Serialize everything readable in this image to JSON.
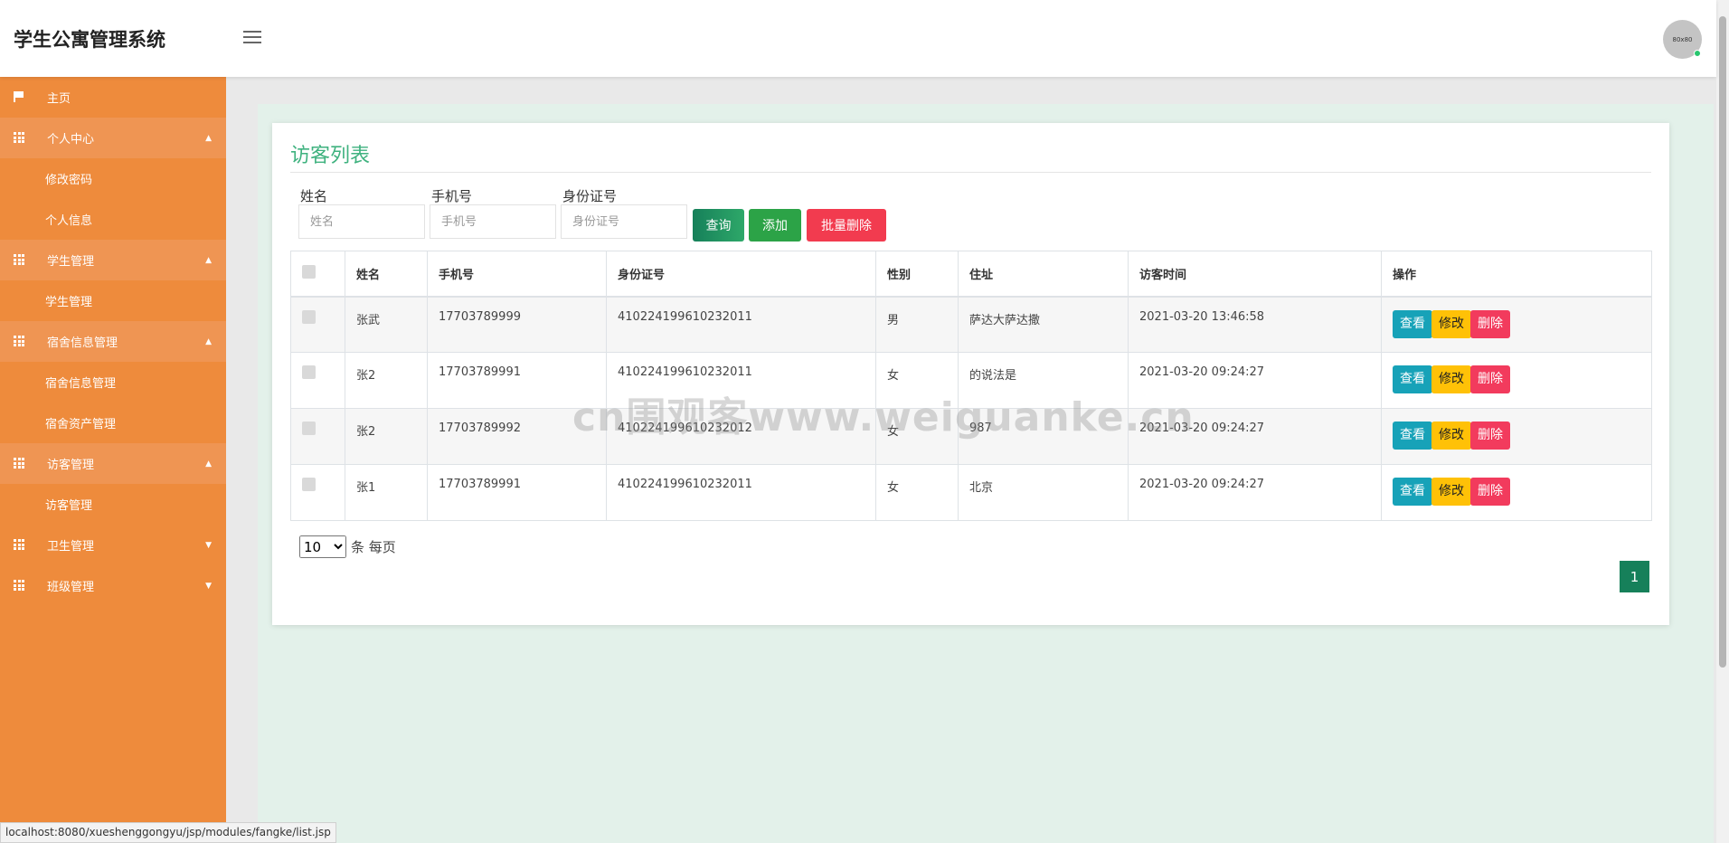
{
  "header": {
    "brand": "学生公寓管理系统",
    "avatar_text": "80x80",
    "avatar_bg": "#c4c4c4"
  },
  "sidebar": {
    "bg_color": "#ee8b3c",
    "home": "主页",
    "groups": [
      {
        "label": "个人中心",
        "caret": "▲",
        "items": [
          "修改密码",
          "个人信息"
        ]
      },
      {
        "label": "学生管理",
        "caret": "▲",
        "items": [
          "学生管理"
        ]
      },
      {
        "label": "宿舍信息管理",
        "caret": "▲",
        "items": [
          "宿舍信息管理",
          "宿舍资产管理"
        ]
      },
      {
        "label": "访客管理",
        "caret": "▲",
        "items": [
          "访客管理"
        ]
      },
      {
        "label": "卫生管理",
        "caret": "▼",
        "items": []
      },
      {
        "label": "班级管理",
        "caret": "▼",
        "items": []
      }
    ]
  },
  "page": {
    "title": "访客列表",
    "title_color": "#3fb27f",
    "filters": {
      "name_label": "姓名",
      "name_placeholder": "姓名",
      "phone_label": "手机号",
      "phone_placeholder": "手机号",
      "id_label": "身份证号",
      "id_placeholder": "身份证号"
    },
    "buttons": {
      "search": "查询",
      "add": "添加",
      "bulk_delete": "批量删除"
    },
    "table": {
      "headers": [
        "姓名",
        "手机号",
        "身份证号",
        "性别",
        "住址",
        "访客时间",
        "操作"
      ],
      "rows": [
        {
          "name": "张武",
          "phone": "17703789999",
          "id": "410224199610232011",
          "gender": "男",
          "address": "萨达大萨达撒",
          "time": "2021-03-20 13:46:58"
        },
        {
          "name": "张2",
          "phone": "17703789991",
          "id": "410224199610232011",
          "gender": "女",
          "address": "的说法是",
          "time": "2021-03-20 09:24:27"
        },
        {
          "name": "张2",
          "phone": "17703789992",
          "id": "410224199610232012",
          "gender": "女",
          "address": "987",
          "time": "2021-03-20 09:24:27"
        },
        {
          "name": "张1",
          "phone": "17703789991",
          "id": "410224199610232011",
          "gender": "女",
          "address": "北京",
          "time": "2021-03-20 09:24:27"
        }
      ],
      "actions": {
        "view": "查看",
        "edit": "修改",
        "delete": "删除"
      }
    },
    "pagination": {
      "page_size": "10",
      "page_size_suffix": "条 每页",
      "current_page": "1"
    }
  },
  "watermark": "cn围观客www.weiguanke.cn",
  "status_url": "localhost:8080/xueshenggongyu/jsp/modules/fangke/list.jsp"
}
